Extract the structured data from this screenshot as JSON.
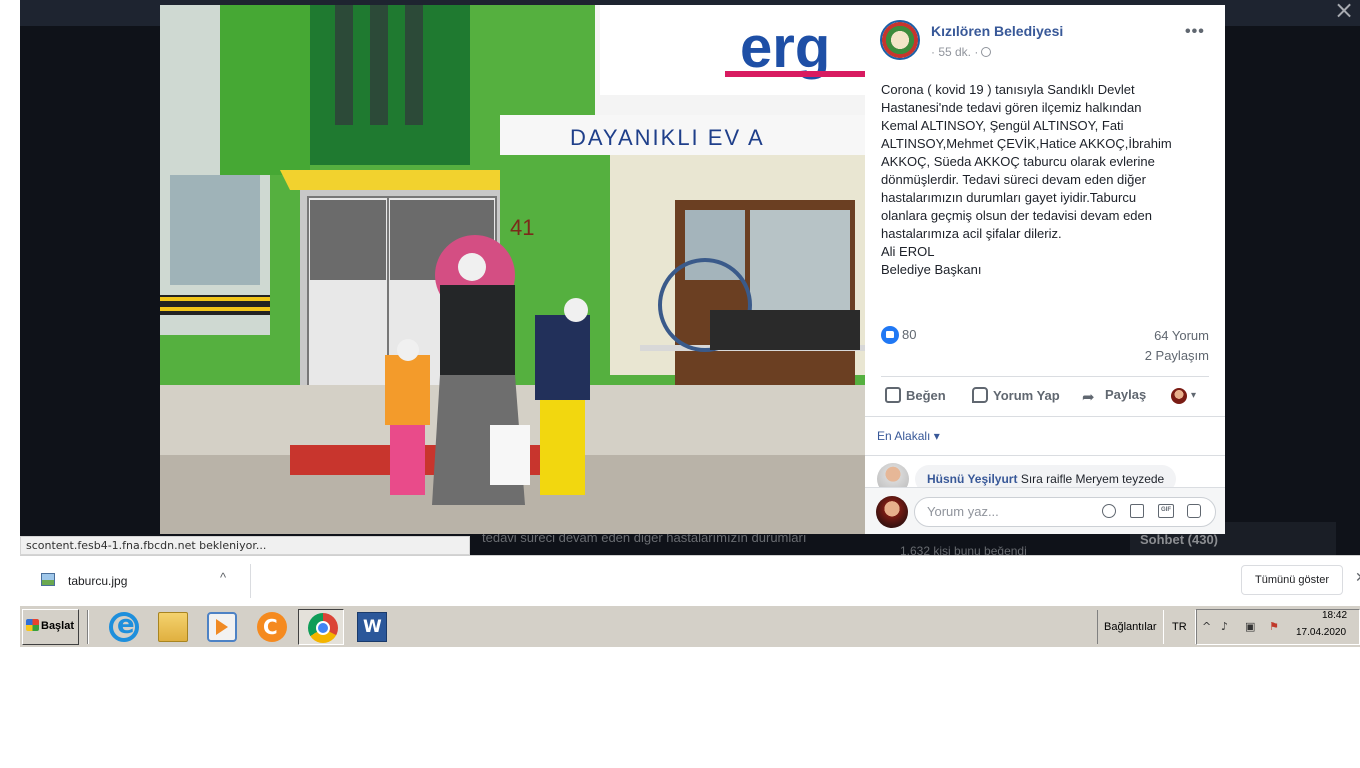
{
  "viewer": {
    "close_glyph": "×",
    "status_url": "scontent.fesb4-1.fna.fbcdn.net bekleniyor...",
    "behind_text": "tedavi süreci devam eden diğer hastalarımızın durumları",
    "behind_likes": "1.632 kişi bunu beğendi",
    "behind_chat": "Sohbet (430)"
  },
  "post": {
    "page_name": "Kızılören Belediyesi",
    "time": "· 55 dk. ·",
    "more_glyph": "•••",
    "text_lines": [
      "Corona ( kovid 19 ) tanısıyla Sandıklı Devlet",
      "Hastanesi'nde tedavi gören ilçemiz halkından",
      "Kemal ALTINSOY, Şengül ALTINSOY, Fati",
      "ALTINSOY,Mehmet ÇEVİK,Hatice AKKOÇ,İbrahim",
      "AKKOÇ, Süeda AKKOÇ taburcu olarak evlerine",
      "dönmüşlerdir. Tedavi süreci devam eden diğer",
      "hastalarımızın durumları gayet iyidir.Taburcu",
      "olanlara geçmiş olsun der tedavisi devam eden",
      "hastalarımıza acil şifalar dileriz.",
      "Ali EROL",
      "Belediye Başkanı"
    ],
    "likes": "80",
    "comments": "64 Yorum",
    "shares": "2 Paylaşım",
    "actions": {
      "like": "Beğen",
      "comment": "Yorum Yap",
      "share": "Paylaş",
      "caret": "▾"
    },
    "sort_label": "En Alakalı ▾",
    "comment": {
      "author": "Hüsnü Yeşilyurt",
      "text": "Sıra raifle Meryem teyzede"
    },
    "comment_placeholder": "Yorum yaz...",
    "gif_label": "GIF"
  },
  "downloads": {
    "file_name": "taburcu.jpg",
    "caret": "^",
    "show_all": "Tümünü göster",
    "close_glyph": "✕"
  },
  "taskbar": {
    "start_label": "Başlat",
    "links_label": "Bağlantılar",
    "lang": "TR",
    "tray_up": "^",
    "time": "18:42",
    "date": "17.04.2020"
  }
}
